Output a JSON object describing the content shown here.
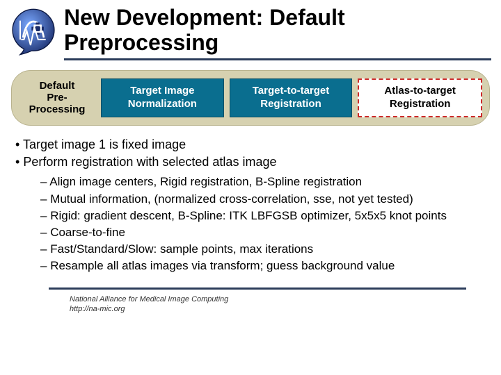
{
  "title": "New Development: Default Preprocessing",
  "pipeline": {
    "label_l1": "Default",
    "label_l2": "Pre-",
    "label_l3": "Processing",
    "box1_l1": "Target Image",
    "box1_l2": "Normalization",
    "box2_l1": "Target-to-target",
    "box2_l2": "Registration",
    "box3_l1": "Atlas-to-target",
    "box3_l2": "Registration"
  },
  "bullets": {
    "b1": "Target image 1 is fixed image",
    "b2": "Perform registration with selected atlas image"
  },
  "subs": {
    "s1": "Align image centers, Rigid registration, B-Spline registration",
    "s2": "Mutual information, (normalized cross-correlation, sse, not yet tested)",
    "s3": "Rigid: gradient descent, B-Spline: ITK LBFGSB optimizer, 5x5x5 knot points",
    "s4": "Coarse-to-fine",
    "s5": "Fast/Standard/Slow: sample points, max iterations",
    "s6": "Resample all atlas images via transform; guess background value"
  },
  "footer": {
    "l1": "National Alliance for Medical Image Computing",
    "l2": "http://na-mic.org"
  }
}
